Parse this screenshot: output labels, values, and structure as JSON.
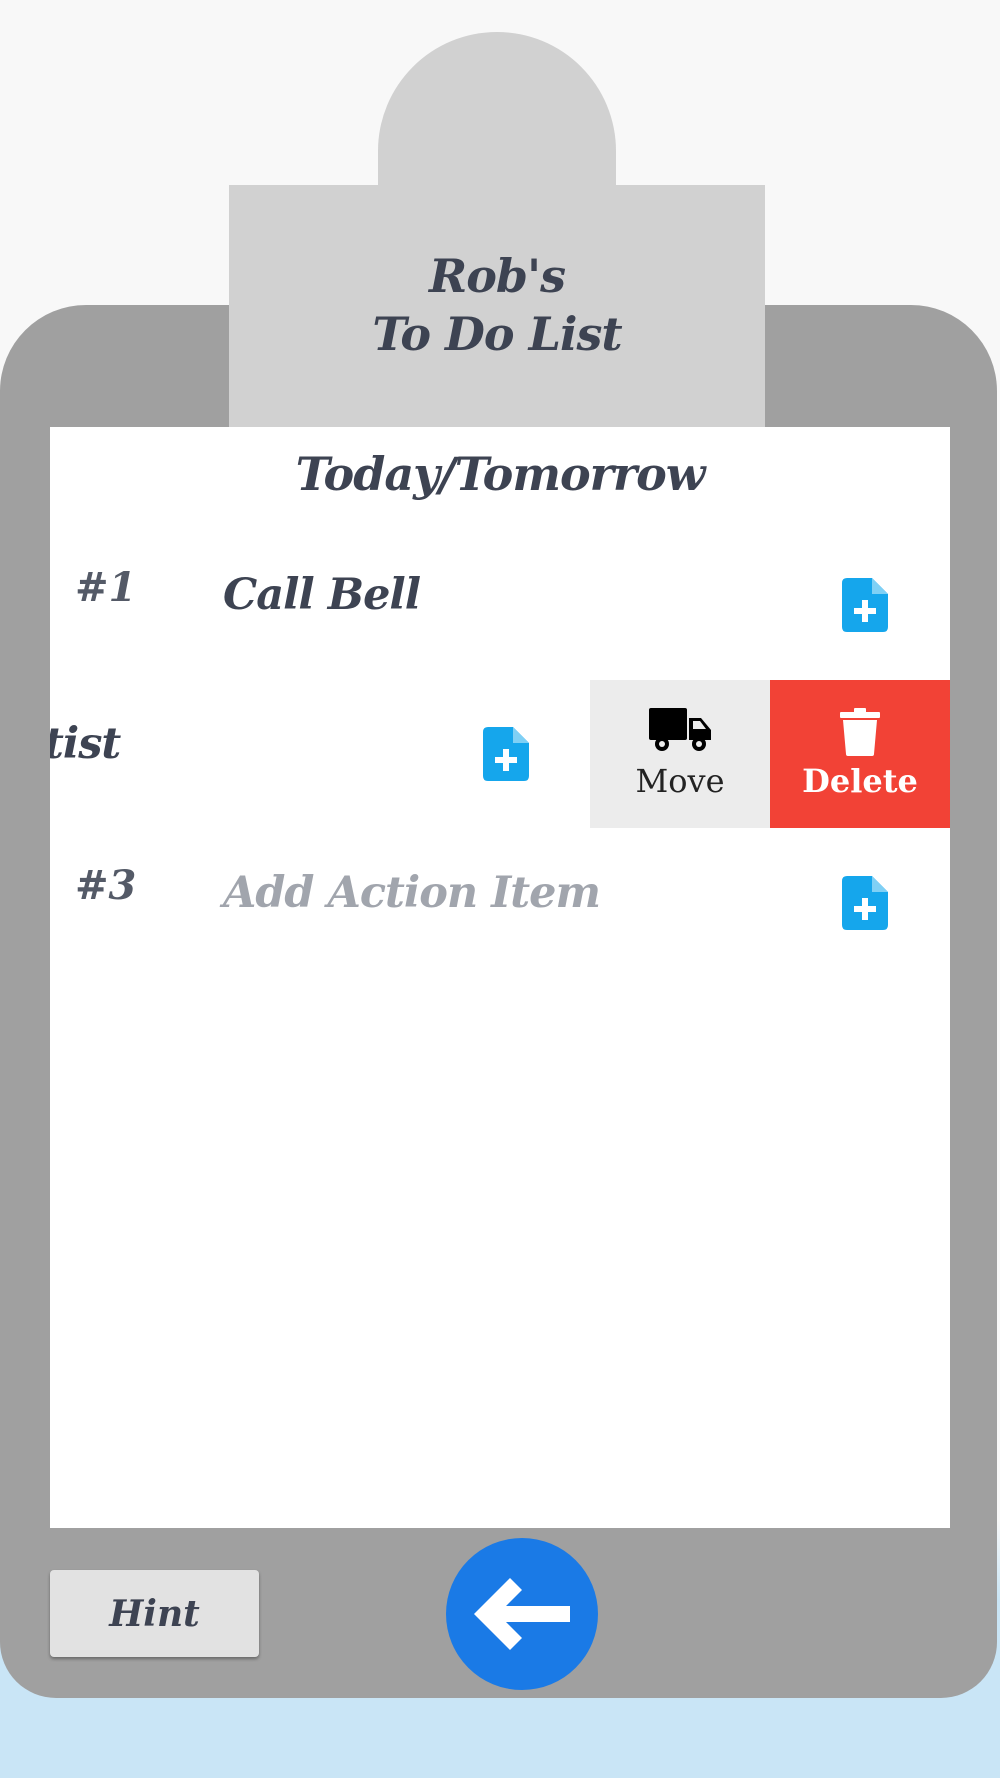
{
  "clipboard": {
    "title_line1": "Rob's",
    "title_line2": "To Do List"
  },
  "list": {
    "heading": "Today/Tomorrow",
    "items": [
      {
        "number": "#1",
        "text": "Call Bell",
        "placeholder": false
      },
      {
        "number": "",
        "text": "tist",
        "placeholder": false
      },
      {
        "number": "#3",
        "text": "Add Action Item",
        "placeholder": true
      }
    ],
    "add_icon": "file-plus-icon"
  },
  "swipe_actions": {
    "move_label": "Move",
    "move_icon": "truck-icon",
    "delete_label": "Delete",
    "delete_icon": "trash-icon"
  },
  "footer": {
    "hint_label": "Hint",
    "back_icon": "arrow-left-icon"
  },
  "colors": {
    "accent_blue": "#1a7ae6",
    "icon_blue": "#15a6ec",
    "delete_red": "#f24236",
    "board_gray": "#a0a0a0",
    "tab_gray": "#d1d1d1"
  }
}
